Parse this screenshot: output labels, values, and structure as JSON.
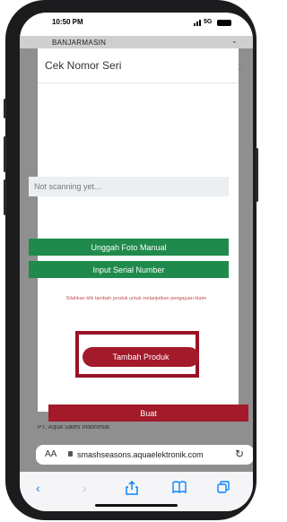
{
  "status_bar": {
    "time": "10:50 PM",
    "network": "5G"
  },
  "background_page": {
    "city_select": "BANJARMASIN",
    "footer_peek": "PT. Aqua Sales Indonesia"
  },
  "modal": {
    "title": "Cek Nomor Seri",
    "scan_status": "Not scanning yet...",
    "upload_photo_button": "Unggah Foto Manual",
    "input_serial_button": "Input Serial Number",
    "hint": "Silahkan klik tambah produk untuk melanjutkan pengajuan klaim",
    "add_product_button": "Tambah Produk"
  },
  "page": {
    "create_button": "Buat"
  },
  "browser": {
    "text_size": "AA",
    "url": "smashseasons.aquaelektronik.com"
  },
  "colors": {
    "green": "#1f8a4c",
    "red": "#a31a2a",
    "highlight": "#9a1226"
  },
  "icons": [
    "close-icon",
    "chevron-down-icon",
    "lock-icon",
    "reload-icon",
    "back-icon",
    "forward-icon",
    "share-icon",
    "bookmarks-icon",
    "tabs-icon"
  ]
}
